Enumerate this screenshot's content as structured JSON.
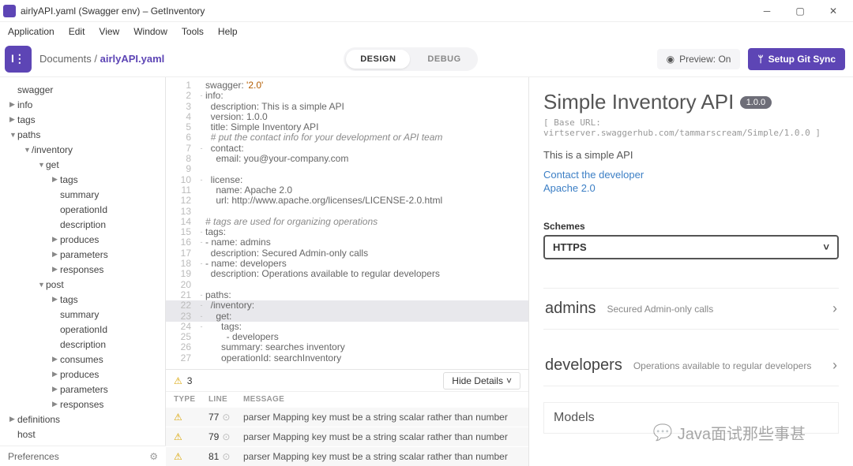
{
  "window": {
    "title": "airlyAPI.yaml (Swagger env) – GetInventory"
  },
  "menu": [
    "Application",
    "Edit",
    "View",
    "Window",
    "Tools",
    "Help"
  ],
  "breadcrumb": {
    "root": "Documents",
    "sep": "/",
    "current": "airlyAPI.yaml"
  },
  "segments": {
    "design": "DESIGN",
    "debug": "DEBUG"
  },
  "preview_toggle": "Preview: On",
  "git_button": "Setup Git Sync",
  "tree": [
    {
      "d": 0,
      "t": "",
      "l": "swagger"
    },
    {
      "d": 0,
      "t": "▶",
      "l": "info"
    },
    {
      "d": 0,
      "t": "▶",
      "l": "tags"
    },
    {
      "d": 0,
      "t": "▼",
      "l": "paths"
    },
    {
      "d": 1,
      "t": "▼",
      "l": "/inventory"
    },
    {
      "d": 2,
      "t": "▼",
      "l": "get"
    },
    {
      "d": 3,
      "t": "▶",
      "l": "tags"
    },
    {
      "d": 3,
      "t": "",
      "l": "summary"
    },
    {
      "d": 3,
      "t": "",
      "l": "operationId"
    },
    {
      "d": 3,
      "t": "",
      "l": "description"
    },
    {
      "d": 3,
      "t": "▶",
      "l": "produces"
    },
    {
      "d": 3,
      "t": "▶",
      "l": "parameters"
    },
    {
      "d": 3,
      "t": "▶",
      "l": "responses"
    },
    {
      "d": 2,
      "t": "▼",
      "l": "post"
    },
    {
      "d": 3,
      "t": "▶",
      "l": "tags"
    },
    {
      "d": 3,
      "t": "",
      "l": "summary"
    },
    {
      "d": 3,
      "t": "",
      "l": "operationId"
    },
    {
      "d": 3,
      "t": "",
      "l": "description"
    },
    {
      "d": 3,
      "t": "▶",
      "l": "consumes"
    },
    {
      "d": 3,
      "t": "▶",
      "l": "produces"
    },
    {
      "d": 3,
      "t": "▶",
      "l": "parameters"
    },
    {
      "d": 3,
      "t": "▶",
      "l": "responses"
    },
    {
      "d": 0,
      "t": "▶",
      "l": "definitions"
    },
    {
      "d": 0,
      "t": "",
      "l": "host"
    }
  ],
  "preferences_label": "Preferences",
  "code": [
    {
      "n": 1,
      "m": "",
      "t": "swagger: '2.0'",
      "hl": false
    },
    {
      "n": 2,
      "m": "-",
      "t": "info:",
      "hl": false
    },
    {
      "n": 3,
      "m": "",
      "t": "  description: This is a simple API",
      "hl": false
    },
    {
      "n": 4,
      "m": "",
      "t": "  version: 1.0.0",
      "hl": false
    },
    {
      "n": 5,
      "m": "",
      "t": "  title: Simple Inventory API",
      "hl": false
    },
    {
      "n": 6,
      "m": "",
      "t": "  # put the contact info for your development or API team",
      "hl": false
    },
    {
      "n": 7,
      "m": "-",
      "t": "  contact:",
      "hl": false
    },
    {
      "n": 8,
      "m": "",
      "t": "    email: you@your-company.com",
      "hl": false
    },
    {
      "n": 9,
      "m": "",
      "t": "",
      "hl": false
    },
    {
      "n": 10,
      "m": "-",
      "t": "  license:",
      "hl": false
    },
    {
      "n": 11,
      "m": "",
      "t": "    name: Apache 2.0",
      "hl": false
    },
    {
      "n": 12,
      "m": "",
      "t": "    url: http://www.apache.org/licenses/LICENSE-2.0.html",
      "hl": false
    },
    {
      "n": 13,
      "m": "",
      "t": "",
      "hl": false
    },
    {
      "n": 14,
      "m": "",
      "t": "# tags are used for organizing operations",
      "hl": false
    },
    {
      "n": 15,
      "m": "-",
      "t": "tags:",
      "hl": false
    },
    {
      "n": 16,
      "m": "-",
      "t": "- name: admins",
      "hl": false
    },
    {
      "n": 17,
      "m": "",
      "t": "  description: Secured Admin-only calls",
      "hl": false
    },
    {
      "n": 18,
      "m": "-",
      "t": "- name: developers",
      "hl": false
    },
    {
      "n": 19,
      "m": "",
      "t": "  description: Operations available to regular developers",
      "hl": false
    },
    {
      "n": 20,
      "m": "",
      "t": "",
      "hl": false
    },
    {
      "n": 21,
      "m": "-",
      "t": "paths:",
      "hl": false
    },
    {
      "n": 22,
      "m": "-",
      "t": "  /inventory:",
      "hl": true
    },
    {
      "n": 23,
      "m": "-",
      "t": "    get:",
      "hl": true
    },
    {
      "n": 24,
      "m": "-",
      "t": "      tags:",
      "hl": false
    },
    {
      "n": 25,
      "m": "",
      "t": "        - developers",
      "hl": false
    },
    {
      "n": 26,
      "m": "",
      "t": "      summary: searches inventory",
      "hl": false
    },
    {
      "n": 27,
      "m": "",
      "t": "      operationId: searchInventory",
      "hl": false
    }
  ],
  "problems": {
    "count": "3",
    "hide": "Hide Details",
    "headers": {
      "type": "TYPE",
      "line": "LINE",
      "message": "MESSAGE"
    },
    "rows": [
      {
        "line": "77",
        "msg": "parser Mapping key must be a string scalar rather than number"
      },
      {
        "line": "79",
        "msg": "parser Mapping key must be a string scalar rather than number"
      },
      {
        "line": "81",
        "msg": "parser Mapping key must be a string scalar rather than number"
      }
    ]
  },
  "preview": {
    "title": "Simple Inventory API",
    "version": "1.0.0",
    "base_url": "[ Base URL: virtserver.swaggerhub.com/tammarscream/Simple/1.0.0 ]",
    "description": "This is a simple API",
    "contact_link": "Contact the developer",
    "license_link": "Apache 2.0",
    "schemes_label": "Schemes",
    "scheme": "HTTPS",
    "tags": [
      {
        "name": "admins",
        "desc": "Secured Admin-only calls"
      },
      {
        "name": "developers",
        "desc": "Operations available to regular developers"
      }
    ],
    "models_label": "Models"
  },
  "watermark": "Java面试那些事甚"
}
